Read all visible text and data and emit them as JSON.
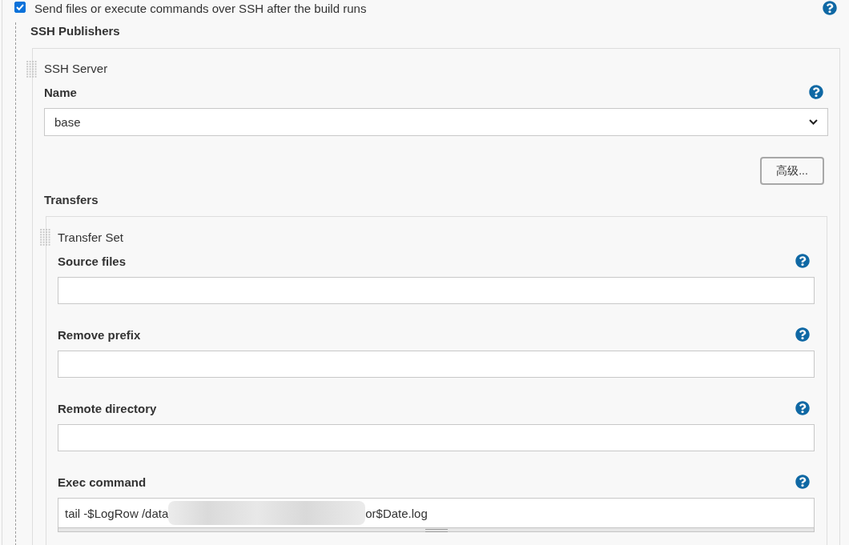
{
  "publish_step": {
    "label": "Send files or execute commands over SSH after the build runs",
    "checked": true
  },
  "section_title": "SSH Publishers",
  "ssh_server": {
    "title": "SSH Server",
    "name_field": {
      "label": "Name",
      "value": "base"
    },
    "advanced_button": "高级...",
    "transfers": {
      "title": "Transfers",
      "transfer_set": {
        "title": "Transfer Set",
        "fields": [
          {
            "kind": "input",
            "label": "Source files"
          },
          {
            "kind": "input",
            "label": "Remove prefix"
          },
          {
            "kind": "input",
            "label": "Remote directory"
          },
          {
            "kind": "textarea",
            "label": "Exec command",
            "value_parts": [
              "tail -$LogRow /data",
              "or$Date.log"
            ],
            "redacted": true
          }
        ]
      }
    }
  }
}
